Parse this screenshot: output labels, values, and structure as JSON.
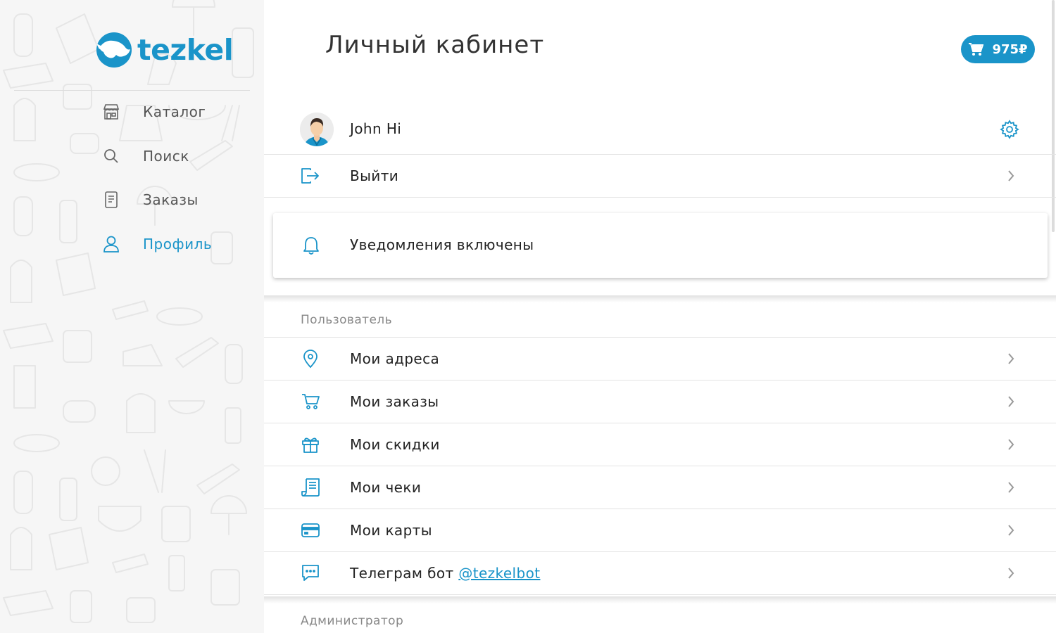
{
  "sidebar": {
    "logo_text": "tezkel",
    "items": [
      {
        "label": "Каталог",
        "icon": "store-icon",
        "active": false
      },
      {
        "label": "Поиск",
        "icon": "search-icon",
        "active": false
      },
      {
        "label": "Заказы",
        "icon": "orders-icon",
        "active": false
      },
      {
        "label": "Профиль",
        "icon": "user-icon",
        "active": true
      }
    ]
  },
  "header": {
    "title": "Личный кабинет",
    "cart_total": "975₽"
  },
  "profile": {
    "name": "John Hi",
    "logout_label": "Выйти"
  },
  "notifications": {
    "label": "Уведомления включены"
  },
  "user_section": {
    "title": "Пользователь",
    "items": [
      {
        "label": "Мои адреса",
        "icon": "location-pin-icon"
      },
      {
        "label": "Мои заказы",
        "icon": "cart-icon"
      },
      {
        "label": "Мои скидки",
        "icon": "gift-icon"
      },
      {
        "label": "Мои чеки",
        "icon": "receipt-icon"
      },
      {
        "label": "Мои карты",
        "icon": "credit-card-icon"
      }
    ],
    "telegram": {
      "label": "Телеграм бот",
      "link": "@tezkelbot",
      "icon": "chat-icon"
    }
  },
  "admin_section": {
    "title": "Администратор"
  },
  "colors": {
    "accent": "#1a94c9",
    "sidebar_bg": "#f6f6f6"
  }
}
